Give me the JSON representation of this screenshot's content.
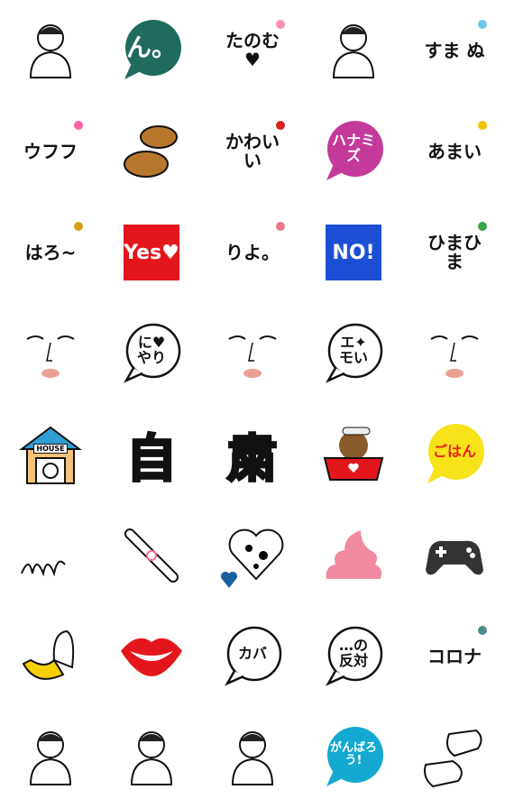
{
  "stickers": [
    {
      "kind": "person",
      "name": "sumo-wrestler",
      "text": ""
    },
    {
      "kind": "bubble",
      "name": "n-bubble",
      "text": "ん。",
      "color": "#1f6b5e",
      "fg": "#ffffff"
    },
    {
      "kind": "text",
      "name": "tanomu",
      "text": "たのむ♥",
      "fg": "#111111",
      "accent": "#ff8fb8"
    },
    {
      "kind": "person",
      "name": "squatting-man",
      "text": ""
    },
    {
      "kind": "text",
      "name": "sumanu",
      "text": "すま ぬ",
      "fg": "#111111",
      "accent": "#6fc6e8"
    },
    {
      "kind": "text",
      "name": "ufufu",
      "text": "ウフフ",
      "fg": "#111111",
      "accent": "#ff5fa8"
    },
    {
      "kind": "dorayaki",
      "name": "dorayaki",
      "text": ""
    },
    {
      "kind": "text",
      "name": "kawaii",
      "text": "かわいい",
      "fg": "#111111",
      "accent": "#d9231d"
    },
    {
      "kind": "bubble",
      "name": "hanamizu-jar",
      "text": "ハナミズ",
      "color": "#c43a9a",
      "fg": "#ffffff"
    },
    {
      "kind": "text",
      "name": "amai",
      "text": "あまい",
      "fg": "#111111",
      "accent": "#f5c400"
    },
    {
      "kind": "text",
      "name": "haro",
      "text": "はろ~",
      "fg": "#111111",
      "accent": "#d4a017"
    },
    {
      "kind": "square",
      "name": "yes-square",
      "text": "Yes♥",
      "color": "#e3161c"
    },
    {
      "kind": "text",
      "name": "riyo",
      "text": "りよ。",
      "fg": "#111111",
      "accent": "#e97a8a"
    },
    {
      "kind": "square",
      "name": "no-square",
      "text": "NO!",
      "color": "#1c4fd6"
    },
    {
      "kind": "text",
      "name": "himahima",
      "text": "ひまひま",
      "fg": "#111111",
      "accent": "#3aa64a"
    },
    {
      "kind": "face",
      "name": "face-lips",
      "text": ""
    },
    {
      "kind": "obubble",
      "name": "nyari-bubble",
      "text": "に♥ やり",
      "fg": "#111111"
    },
    {
      "kind": "face",
      "name": "face-sparkle",
      "text": ""
    },
    {
      "kind": "obubble",
      "name": "emoi-bubble",
      "text": "エ✦ モい",
      "fg": "#111111"
    },
    {
      "kind": "face",
      "name": "face-crying",
      "text": ""
    },
    {
      "kind": "house",
      "name": "dog-house",
      "text": "HOUSE"
    },
    {
      "kind": "glyph",
      "name": "kanji-ji",
      "text": "自"
    },
    {
      "kind": "glyph",
      "name": "kanji-shuku",
      "text": "粛"
    },
    {
      "kind": "bowl",
      "name": "dog-bowl",
      "text": ""
    },
    {
      "kind": "bubble",
      "name": "gohan-bubble",
      "text": "ごはん",
      "color": "#f8e21a",
      "fg": "#e2231a"
    },
    {
      "kind": "squiggle",
      "name": "squiggle",
      "text": ""
    },
    {
      "kind": "bone",
      "name": "bone-ribbon",
      "text": ""
    },
    {
      "kind": "heart",
      "name": "dalmatian-heart",
      "text": ""
    },
    {
      "kind": "poop",
      "name": "pink-poop",
      "text": ""
    },
    {
      "kind": "gamepad",
      "name": "game-controller",
      "text": ""
    },
    {
      "kind": "banana",
      "name": "banana",
      "text": ""
    },
    {
      "kind": "lips",
      "name": "red-lips",
      "text": ""
    },
    {
      "kind": "obubble",
      "name": "kaba-hippo",
      "text": "カバ",
      "fg": "#111111"
    },
    {
      "kind": "obubble",
      "name": "no-hantai-bubble",
      "text": "…の 反対",
      "fg": "#111111"
    },
    {
      "kind": "text",
      "name": "corona",
      "text": "コロナ",
      "fg": "#111111",
      "accent": "#4f8a8b"
    },
    {
      "kind": "person",
      "name": "masked-man",
      "text": ""
    },
    {
      "kind": "person",
      "name": "woman-bangs",
      "text": ""
    },
    {
      "kind": "person",
      "name": "two-people",
      "text": ""
    },
    {
      "kind": "bubble",
      "name": "ganbarou-bubble",
      "text": "がんばろう!",
      "color": "#14a9d0",
      "fg": "#ffffff"
    },
    {
      "kind": "mask",
      "name": "face-masks",
      "text": ""
    }
  ]
}
